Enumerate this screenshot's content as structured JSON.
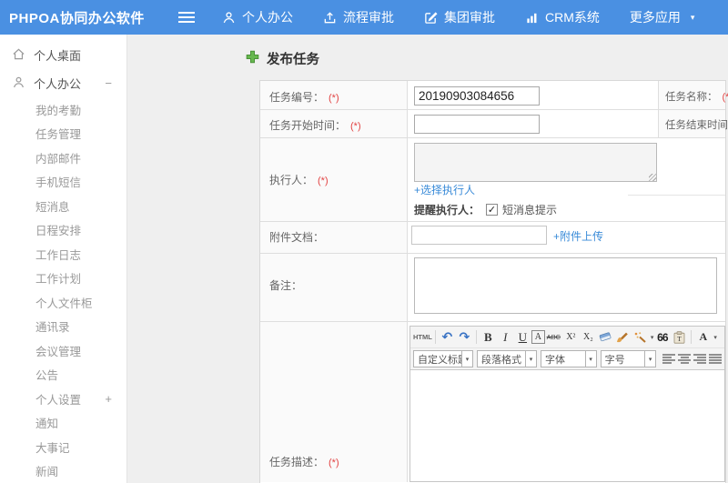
{
  "header": {
    "logo": "PHPOA协同办公软件",
    "caret": "▾",
    "nav": [
      {
        "label": "个人办公"
      },
      {
        "label": "流程审批"
      },
      {
        "label": "集团审批"
      },
      {
        "label": "CRM系统"
      },
      {
        "label": "更多应用"
      }
    ]
  },
  "sidebar": {
    "items": [
      {
        "label": "个人桌面"
      },
      {
        "label": "个人办公",
        "toggle": "−"
      },
      {
        "label": "我的考勤"
      },
      {
        "label": "任务管理"
      },
      {
        "label": "内部邮件"
      },
      {
        "label": "手机短信"
      },
      {
        "label": "短消息"
      },
      {
        "label": "日程安排"
      },
      {
        "label": "工作日志"
      },
      {
        "label": "工作计划"
      },
      {
        "label": "个人文件柜"
      },
      {
        "label": "通讯录"
      },
      {
        "label": "会议管理"
      },
      {
        "label": "公告"
      },
      {
        "label": "个人设置",
        "toggle": "+"
      },
      {
        "label": "通知"
      },
      {
        "label": "大事记"
      },
      {
        "label": "新闻"
      }
    ]
  },
  "main": {
    "page_title": "发布任务",
    "required": "(*)",
    "form": {
      "task_no_label": "任务编号：",
      "task_no_value": "20190903084656",
      "task_name_label": "任务名称：",
      "start_label": "任务开始时间：",
      "end_label": "任务结束时间：",
      "executor_label": "执行人：",
      "choose_executor": "+选择执行人",
      "remind_label": "提醒执行人：",
      "check": "✓",
      "sms_label": "短消息提示",
      "attach_label": "附件文档：",
      "attach_upload": "+附件上传",
      "remark_label": "备注：",
      "desc_label": "任务描述："
    },
    "editor": {
      "html_btn": "HTML",
      "undo": "↶",
      "redo": "↷",
      "bold": "B",
      "italic": "I",
      "underline": "U",
      "fontbox": "A",
      "strike": "ABC",
      "sup": "X²",
      "sub": "X₂",
      "quote": "66",
      "color": "A",
      "caret": "▾",
      "dropdown_heading": "自定义标题",
      "dropdown_paragraph": "段落格式",
      "dropdown_font": "字体",
      "dropdown_size": "字号"
    }
  },
  "colors": {
    "header_blue": "#4a90e2",
    "link_blue": "#3a8bd8",
    "required_red": "#e24444",
    "plus_green": "#67b84f"
  }
}
